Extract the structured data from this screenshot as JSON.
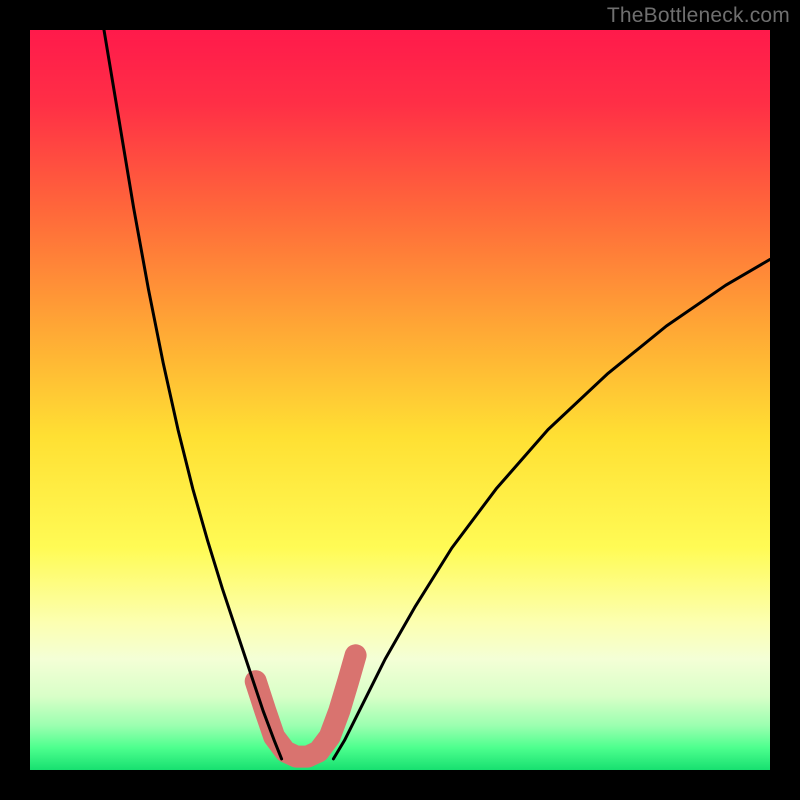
{
  "watermark": "TheBottleneck.com",
  "chart_data": {
    "type": "line",
    "title": "",
    "xlabel": "",
    "ylabel": "",
    "xlim": [
      0,
      100
    ],
    "ylim": [
      0,
      100
    ],
    "grid": false,
    "background_gradient": {
      "stops": [
        {
          "pos": 0.0,
          "color": "#ff1a4b"
        },
        {
          "pos": 0.1,
          "color": "#ff2f46"
        },
        {
          "pos": 0.25,
          "color": "#ff6a3a"
        },
        {
          "pos": 0.4,
          "color": "#ffa635"
        },
        {
          "pos": 0.55,
          "color": "#ffe033"
        },
        {
          "pos": 0.7,
          "color": "#fffb55"
        },
        {
          "pos": 0.8,
          "color": "#fcffb0"
        },
        {
          "pos": 0.85,
          "color": "#f4ffd6"
        },
        {
          "pos": 0.9,
          "color": "#d9ffc8"
        },
        {
          "pos": 0.94,
          "color": "#9bffb0"
        },
        {
          "pos": 0.97,
          "color": "#4dff8e"
        },
        {
          "pos": 1.0,
          "color": "#17e070"
        }
      ]
    },
    "series": [
      {
        "name": "left-curve",
        "color": "#000000",
        "width": 3,
        "x": [
          10.0,
          12.0,
          14.0,
          16.0,
          18.0,
          20.0,
          22.0,
          24.0,
          26.0,
          28.0,
          30.0,
          31.5,
          33.0,
          34.0
        ],
        "y": [
          100.0,
          88.0,
          76.0,
          65.0,
          55.0,
          46.0,
          38.0,
          31.0,
          24.5,
          18.5,
          12.5,
          8.0,
          4.0,
          1.5
        ]
      },
      {
        "name": "right-curve",
        "color": "#000000",
        "width": 3,
        "x": [
          41.0,
          42.5,
          45.0,
          48.0,
          52.0,
          57.0,
          63.0,
          70.0,
          78.0,
          86.0,
          94.0,
          100.0
        ],
        "y": [
          1.5,
          4.0,
          9.0,
          15.0,
          22.0,
          30.0,
          38.0,
          46.0,
          53.5,
          60.0,
          65.5,
          69.0
        ]
      },
      {
        "name": "valley-marker",
        "color": "#d9736f",
        "type": "thick-path",
        "width": 22,
        "x": [
          30.5,
          31.8,
          33.0,
          34.5,
          36.0,
          37.5,
          39.0,
          40.5,
          41.8,
          43.0,
          44.0
        ],
        "y": [
          12.0,
          8.0,
          4.5,
          2.5,
          1.8,
          1.8,
          2.5,
          4.5,
          8.0,
          12.0,
          15.5
        ]
      }
    ]
  }
}
